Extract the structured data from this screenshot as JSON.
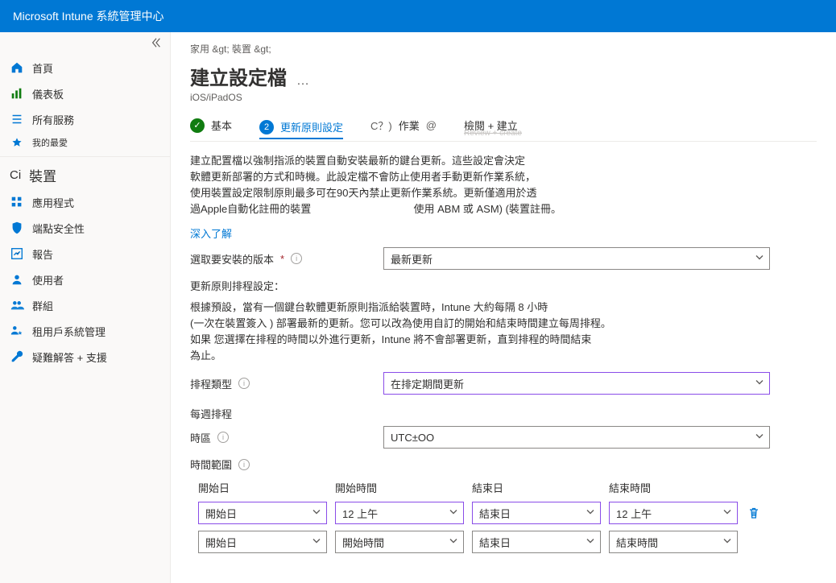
{
  "app_title": "Microsoft Intune 系統管理中心",
  "sidebar": {
    "items": [
      {
        "icon": "home",
        "label": "首頁"
      },
      {
        "icon": "dashboard",
        "label": "儀表板"
      },
      {
        "icon": "list",
        "label": "所有服務"
      }
    ],
    "favorites_label": "我的最愛",
    "devices_heading": "裝置",
    "items2": [
      {
        "icon": "apps",
        "label": "應用程式"
      },
      {
        "icon": "shield",
        "label": "端點安全性"
      },
      {
        "icon": "report",
        "label": "報告"
      },
      {
        "icon": "user",
        "label": "使用者"
      },
      {
        "icon": "group",
        "label": "群組"
      },
      {
        "icon": "tenant",
        "label": "租用戶系統管理"
      },
      {
        "icon": "support",
        "label": "疑難解答 + 支援"
      }
    ]
  },
  "breadcrumb": "家用 &gt;  裝置 &gt;",
  "page_title": "建立設定檔",
  "page_title_dots": "…",
  "page_sub": "iOS/iPadOS",
  "steps": {
    "s1": "基本",
    "s2": "更新原則設定",
    "s3_label": "作業",
    "s3_prefix": "C？)",
    "s3_suffix": "@",
    "s4": "檢閱 + 建立",
    "s4_strike": "Review + create"
  },
  "desc_lines": [
    "建立配置檔以強制指派的裝置自動安裝最新的鍵台更新。這些設定會決定",
    "軟體更新部署的方式和時機。此設定檔不會防止使用者手動更新作業系統，",
    "使用裝置設定限制原則最多可在90天內禁止更新作業系統。更新僅適用於透",
    "過Apple自動化註冊的裝置"
  ],
  "desc_tail": "使用 ABM 或 ASM)  (裝置註冊。",
  "learn_more": "深入了解",
  "version_label": "選取要安裝的版本",
  "version_req": "*",
  "version_value": "最新更新",
  "sched_settings_label": "更新原則排程設定：",
  "sched_desc_lines": [
    "根據預設，當有一個鍵台軟體更新原則指派給裝置時，Intune 大約每隔 8 小時",
    "(一次在裝置簽入 ) 部署最新的更新。您可以改為使用自訂的開始和結束時間建立每周排程。",
    "如果 您選擇在排程的時間以外進行更新，Intune 將不會部署更新，直到排程的時間結束",
    "為止。"
  ],
  "schedule_type_label": "排程類型",
  "schedule_type_value": "在排定期間更新",
  "weekly_label": "每週排程",
  "tz_label": "時區",
  "tz_value": "UTC±OO",
  "range_label": "時間範圍",
  "sched_cols": [
    "開始日",
    "開始時間",
    "結束日",
    "結束時間"
  ],
  "rows": [
    {
      "startDay": "開始日",
      "startTime": "12 上午",
      "endDay": "結束日",
      "endTime": "12 上午",
      "purple": true,
      "trash": true
    },
    {
      "startDay": "開始日",
      "startTime": "開始時間",
      "endDay": "結束日",
      "endTime": "結束時間",
      "purple": false,
      "trash": false
    }
  ]
}
